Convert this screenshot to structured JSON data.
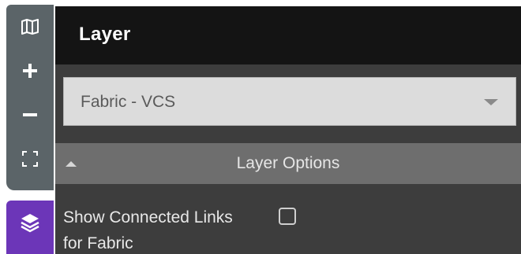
{
  "toolbar": {
    "items": [
      {
        "icon": "map-icon",
        "label": ""
      },
      {
        "icon": "plus-icon",
        "label": ""
      },
      {
        "icon": "minus-icon",
        "label": ""
      },
      {
        "icon": "fullscreen-icon",
        "label": ""
      }
    ],
    "active_tab_icon": "layers-icon",
    "colors": {
      "toolbar_bg": "#5b6468",
      "active_tab_bg": "#6c36b8"
    }
  },
  "panel": {
    "title": "Layer",
    "layer_select": {
      "selected_value": "Fabric - VCS"
    },
    "layer_options": {
      "title": "Layer Options",
      "expanded": true,
      "options": [
        {
          "label": "Show Connected Links for Fabric",
          "checked": false
        }
      ]
    }
  }
}
